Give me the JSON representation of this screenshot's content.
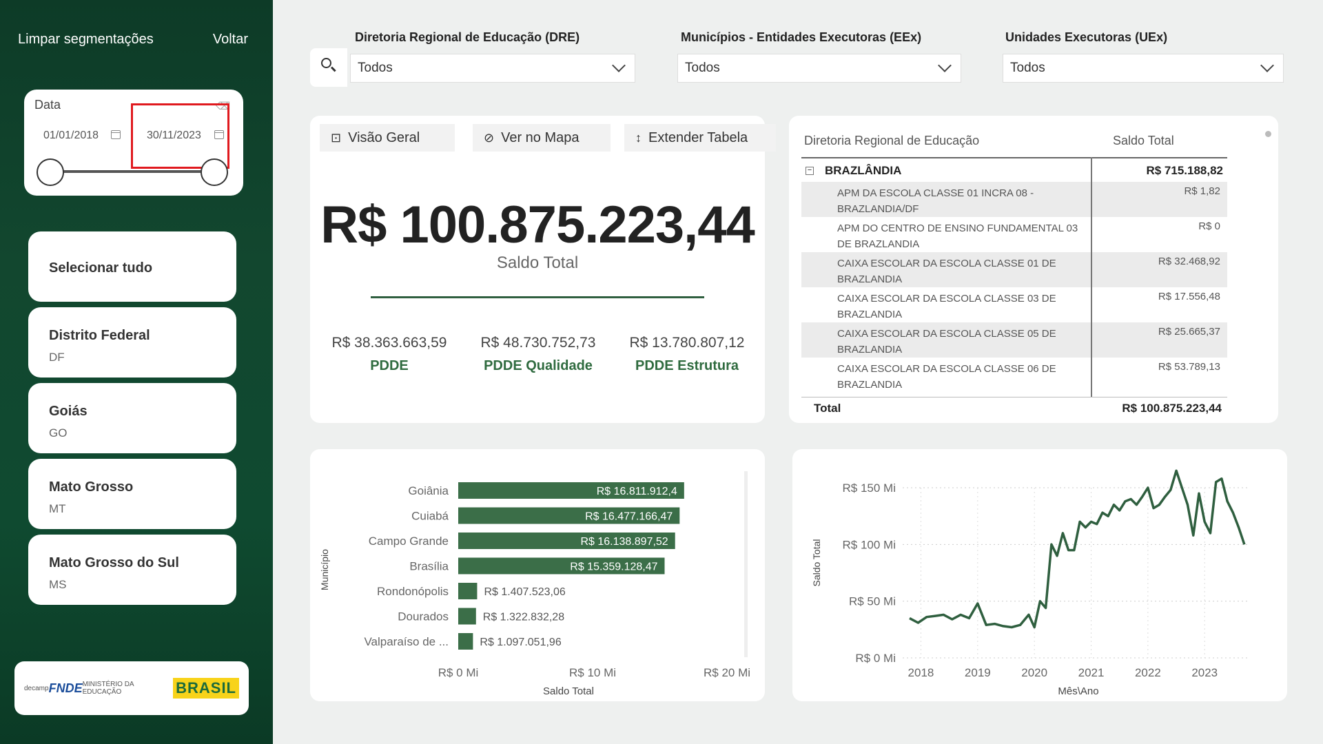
{
  "sidebar": {
    "clear_label": "Limpar segmentações",
    "back_label": "Voltar",
    "date": {
      "label": "Data",
      "start": "01/01/2018",
      "end": "30/11/2023"
    },
    "states": [
      {
        "name": "Selecionar tudo",
        "abbr": ""
      },
      {
        "name": "Distrito Federal",
        "abbr": "DF"
      },
      {
        "name": "Goiás",
        "abbr": "GO"
      },
      {
        "name": "Mato Grosso",
        "abbr": "MT"
      },
      {
        "name": "Mato Grosso do Sul",
        "abbr": "MS"
      }
    ],
    "logos": {
      "decamp": "decamp",
      "fnde": "FNDE",
      "ministry": "MINISTÉRIO DA EDUCAÇÃO",
      "brasil": "BRASIL"
    }
  },
  "filters": [
    {
      "label": "Diretoria Regional de Educação (DRE)",
      "value": "Todos"
    },
    {
      "label": "Municípios - Entidades Executoras (EEx)",
      "value": "Todos"
    },
    {
      "label": "Unidades Executoras (UEx)",
      "value": "Todos"
    }
  ],
  "kpi": {
    "tabs": [
      "Visão Geral",
      "Ver no Mapa",
      "Extender Tabela"
    ],
    "total_value": "R$ 100.875.223,44",
    "total_label": "Saldo Total",
    "subs": [
      {
        "value": "R$ 38.363.663,59",
        "label": "PDDE"
      },
      {
        "value": "R$ 48.730.752,73",
        "label": "PDDE Qualidade"
      },
      {
        "value": "R$ 13.780.807,12",
        "label": "PDDE Estrutura"
      }
    ]
  },
  "table": {
    "col1": "Diretoria Regional de Educação",
    "col2": "Saldo Total",
    "group_name": "BRAZLÂNDIA",
    "group_value": "R$ 715.188,82",
    "rows": [
      {
        "name": "APM DA ESCOLA CLASSE 01 INCRA 08 - BRAZLANDIA/DF",
        "value": "R$ 1,82"
      },
      {
        "name": "APM DO CENTRO DE ENSINO FUNDAMENTAL 03 DE BRAZLANDIA",
        "value": "R$ 0"
      },
      {
        "name": "CAIXA ESCOLAR DA ESCOLA CLASSE 01 DE BRAZLANDIA",
        "value": "R$ 32.468,92"
      },
      {
        "name": "CAIXA ESCOLAR DA ESCOLA CLASSE 03 DE BRAZLANDIA",
        "value": "R$ 17.556,48"
      },
      {
        "name": "CAIXA ESCOLAR DA ESCOLA CLASSE 05 DE BRAZLANDIA",
        "value": "R$ 25.665,37"
      },
      {
        "name": "CAIXA ESCOLAR DA ESCOLA CLASSE 06 DE BRAZLANDIA",
        "value": "R$ 53.789,13"
      }
    ],
    "total_label": "Total",
    "total_value": "R$ 100.875.223,44"
  },
  "colors": {
    "brand_green": "#2f5f3f",
    "sidebar_bg": "#0f4a30",
    "highlight_red": "#e0191e"
  },
  "chart_data": [
    {
      "type": "bar",
      "orientation": "horizontal",
      "xlabel": "Saldo Total",
      "ylabel": "Município",
      "xlim": [
        0,
        20000000
      ],
      "xticks": [
        "R$ 0 Mi",
        "R$ 10 Mi",
        "R$ 20 Mi"
      ],
      "categories": [
        "Goiânia",
        "Cuiabá",
        "Campo Grande",
        "Brasília",
        "Rondonópolis",
        "Dourados",
        "Valparaíso de ..."
      ],
      "values": [
        16811912.4,
        16477166.47,
        16138897.52,
        15359128.47,
        1407523.06,
        1322832.28,
        1097051.96
      ],
      "labels": [
        "R$ 16.811.912,4",
        "R$ 16.477.166,47",
        "R$ 16.138.897,52",
        "R$ 15.359.128,47",
        "R$ 1.407.523,06",
        "R$ 1.322.832,28",
        "R$ 1.097.051,96"
      ],
      "color": "#3b6e48"
    },
    {
      "type": "line",
      "xlabel": "Mês\\Ano",
      "ylabel": "Saldo Total",
      "ylim": [
        0,
        150
      ],
      "yticks": [
        "R$ 0 Mi",
        "R$ 50 Mi",
        "R$ 100 Mi",
        "R$ 150 Mi"
      ],
      "xticks": [
        "2018",
        "2019",
        "2020",
        "2021",
        "2022",
        "2023"
      ],
      "x": [
        2017.9,
        2018.05,
        2018.2,
        2018.35,
        2018.5,
        2018.65,
        2018.8,
        2018.95,
        2019.1,
        2019.25,
        2019.4,
        2019.55,
        2019.7,
        2019.85,
        2020.0,
        2020.1,
        2020.2,
        2020.3,
        2020.4,
        2020.5,
        2020.6,
        2020.7,
        2020.8,
        2020.9,
        2021.0,
        2021.1,
        2021.2,
        2021.3,
        2021.4,
        2021.5,
        2021.6,
        2021.7,
        2021.8,
        2021.9,
        2022.0,
        2022.1,
        2022.2,
        2022.3,
        2022.4,
        2022.5,
        2022.6,
        2022.7,
        2022.8,
        2022.9,
        2023.0,
        2023.1,
        2023.2,
        2023.3,
        2023.4,
        2023.5,
        2023.6,
        2023.7,
        2023.8
      ],
      "values": [
        35,
        31,
        36,
        37,
        38,
        34,
        38,
        35,
        48,
        29,
        30,
        28,
        27,
        29,
        38,
        27,
        50,
        44,
        100,
        90,
        110,
        95,
        95,
        120,
        115,
        120,
        118,
        128,
        125,
        135,
        130,
        138,
        140,
        135,
        142,
        150,
        132,
        135,
        142,
        148,
        165,
        150,
        135,
        108,
        145,
        120,
        110,
        155,
        158,
        138,
        128,
        115,
        100
      ],
      "color": "#2f5f3f"
    }
  ]
}
